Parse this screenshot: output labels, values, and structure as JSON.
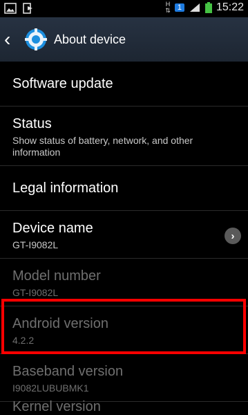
{
  "status_bar": {
    "time": "15:22",
    "sim_badge": "1",
    "network_type_icon": "H",
    "left_icons": [
      "image-notification-icon",
      "sign-in-icon"
    ],
    "right_icons": [
      "hspa-icon",
      "sim1-icon",
      "signal-icon",
      "battery-icon"
    ]
  },
  "action_bar": {
    "back_icon": "chevron-left",
    "settings_icon": "gear",
    "title": "About device"
  },
  "list": [
    {
      "title": "Software update",
      "subtitle": "",
      "enabled": true
    },
    {
      "title": "Status",
      "subtitle": "Show status of battery, network, and other information",
      "enabled": true
    },
    {
      "title": "Legal information",
      "subtitle": "",
      "enabled": true
    },
    {
      "title": "Device name",
      "subtitle": "GT-I9082L",
      "enabled": true,
      "has_chevron": true
    },
    {
      "title": "Model number",
      "subtitle": "GT-I9082L",
      "enabled": false
    },
    {
      "title": "Android version",
      "subtitle": "4.2.2",
      "enabled": false,
      "highlighted": true
    },
    {
      "title": "Baseband version",
      "subtitle": "I9082LUBUBMK1",
      "enabled": false
    },
    {
      "title": "Kernel version",
      "subtitle": "",
      "enabled": false,
      "partially_visible": true
    }
  ],
  "colors": {
    "background": "#000000",
    "action_bar": "#1d2632",
    "highlight_box": "#ff0000",
    "disabled_text": "#6f6f6f"
  }
}
